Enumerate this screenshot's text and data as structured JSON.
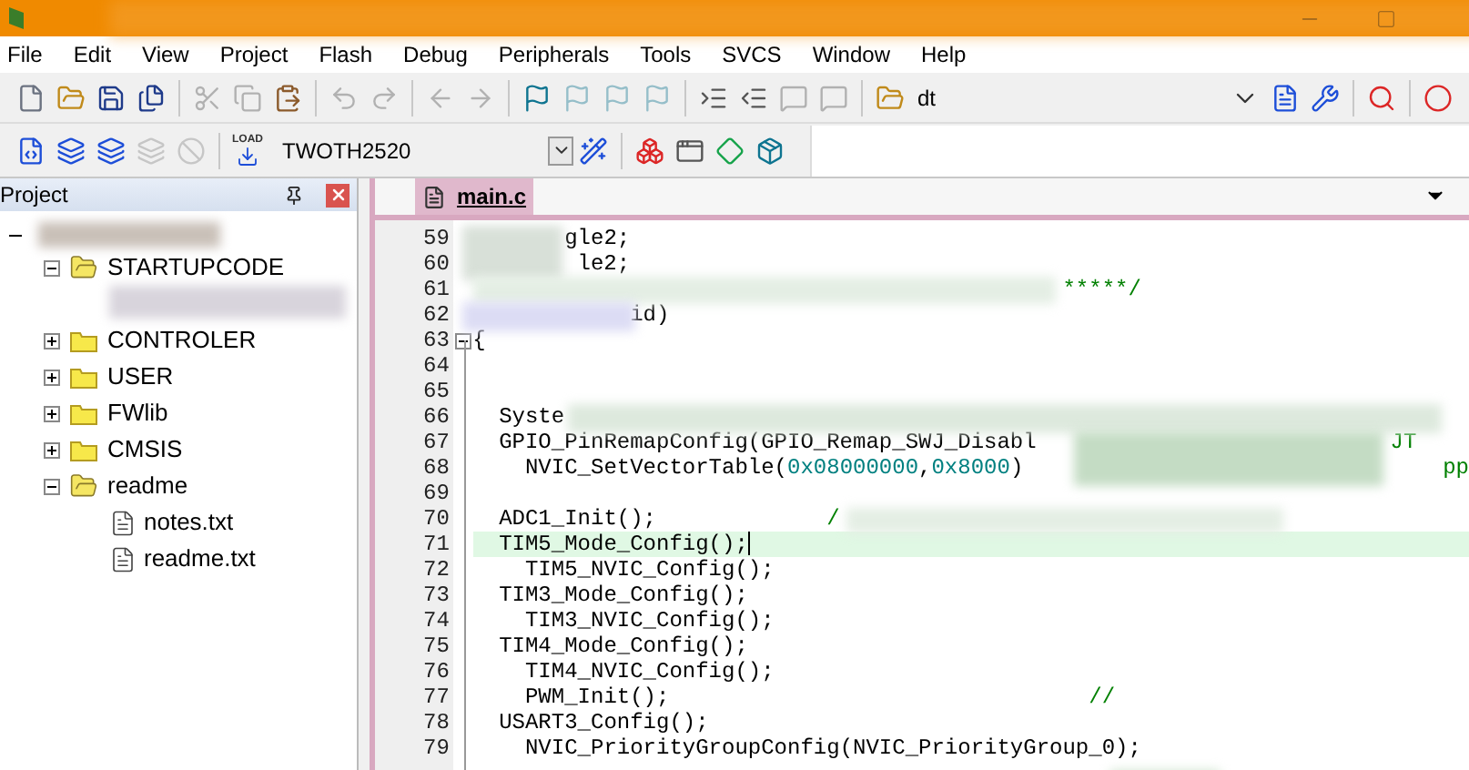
{
  "menu": [
    {
      "label": "File"
    },
    {
      "label": "Edit"
    },
    {
      "label": "View"
    },
    {
      "label": "Project"
    },
    {
      "label": "Flash"
    },
    {
      "label": "Debug"
    },
    {
      "label": "Peripherals"
    },
    {
      "label": "Tools"
    },
    {
      "label": "SVCS"
    },
    {
      "label": "Window"
    },
    {
      "label": "Help"
    }
  ],
  "toolbar": [
    {
      "kind": "new",
      "disabled": false
    },
    {
      "kind": "open",
      "disabled": false
    },
    {
      "kind": "save",
      "disabled": false
    },
    {
      "kind": "saveall",
      "disabled": false
    },
    {
      "kind": "sep"
    },
    {
      "kind": "cut",
      "disabled": true
    },
    {
      "kind": "copy",
      "disabled": true
    },
    {
      "kind": "paste",
      "disabled": false
    },
    {
      "kind": "sep"
    },
    {
      "kind": "undo",
      "disabled": true
    },
    {
      "kind": "redo",
      "disabled": true
    },
    {
      "kind": "sep"
    },
    {
      "kind": "back",
      "disabled": true
    },
    {
      "kind": "forward",
      "disabled": true
    },
    {
      "kind": "sep"
    },
    {
      "kind": "flag",
      "disabled": false
    },
    {
      "kind": "flag",
      "disabled": true
    },
    {
      "kind": "flag",
      "disabled": true
    },
    {
      "kind": "flag",
      "disabled": true
    },
    {
      "kind": "sep"
    },
    {
      "kind": "indent",
      "disabled": false
    },
    {
      "kind": "outdent",
      "disabled": false
    },
    {
      "kind": "comment",
      "disabled": true
    },
    {
      "kind": "comment",
      "disabled": true
    },
    {
      "kind": "sep"
    },
    {
      "kind": "open",
      "disabled": false
    }
  ],
  "find": {
    "value": "dt"
  },
  "toolbar_right": [
    {
      "kind": "dropdown",
      "disabled": false
    },
    {
      "kind": "doc",
      "disabled": false
    },
    {
      "kind": "tool",
      "disabled": false
    },
    {
      "kind": "sep"
    },
    {
      "kind": "debug",
      "disabled": false
    },
    {
      "kind": "sep"
    },
    {
      "kind": "breakpoint",
      "disabled": false
    }
  ],
  "build_toolbar": [
    {
      "kind": "translate",
      "disabled": false
    },
    {
      "kind": "build",
      "disabled": false
    },
    {
      "kind": "rebuild",
      "disabled": false
    },
    {
      "kind": "batch",
      "disabled": true
    },
    {
      "kind": "stop",
      "disabled": true
    },
    {
      "kind": "sep"
    },
    {
      "kind": "load",
      "label": "LOAD",
      "disabled": false
    }
  ],
  "target": {
    "value": "TWOTH2520"
  },
  "build_toolbar_right": [
    {
      "kind": "wand",
      "disabled": false
    },
    {
      "kind": "sep"
    },
    {
      "kind": "blocks",
      "disabled": false
    },
    {
      "kind": "windows",
      "disabled": false
    },
    {
      "kind": "diamond",
      "disabled": false
    },
    {
      "kind": "packs",
      "disabled": false
    }
  ],
  "project": {
    "title": "Project",
    "tree": {
      "expanded": true,
      "children": [
        {
          "kind": "folder",
          "label": "STARTUPCODE",
          "expanded": true,
          "children": [
            {
              "kind": "redacted"
            }
          ]
        },
        {
          "kind": "folder",
          "label": "CONTROLER",
          "expanded": false
        },
        {
          "kind": "folder",
          "label": "USER",
          "expanded": false
        },
        {
          "kind": "folder",
          "label": "FWlib",
          "expanded": false
        },
        {
          "kind": "folder",
          "label": "CMSIS",
          "expanded": false
        },
        {
          "kind": "folder",
          "label": "readme",
          "expanded": true,
          "children": [
            {
              "kind": "file",
              "label": "notes.txt"
            },
            {
              "kind": "file",
              "label": "readme.txt"
            }
          ]
        }
      ]
    }
  },
  "editor": {
    "tabs": [
      {
        "label": "main.c",
        "selected": true
      }
    ],
    "lines": [
      {
        "number": "59",
        "current": false,
        "segments": [
          {
            "kind": "plain",
            "text": "       gle2;"
          }
        ]
      },
      {
        "number": "60",
        "current": false,
        "segments": [
          {
            "kind": "plain",
            "text": "        le2;"
          }
        ]
      },
      {
        "number": "61",
        "current": false,
        "segments": [
          {
            "kind": "comment",
            "text": "                                             *****/"
          }
        ]
      },
      {
        "number": "62",
        "current": false,
        "segments": [
          {
            "kind": "plain",
            "text": "            id)"
          }
        ]
      },
      {
        "number": "63",
        "current": false,
        "fold": true,
        "segments": [
          {
            "kind": "plain",
            "text": "{"
          }
        ]
      },
      {
        "number": "64",
        "current": false
      },
      {
        "number": "65",
        "current": false
      },
      {
        "number": "66",
        "current": false,
        "segments": [
          {
            "kind": "plain",
            "text": "  Syste"
          }
        ]
      },
      {
        "number": "67",
        "current": false,
        "segments": [
          {
            "kind": "plain",
            "text": "  GPIO_PinRemapConfig(GPIO_Remap_SWJ_Disabl"
          },
          {
            "kind": "comment",
            "text": "                           JT"
          }
        ]
      },
      {
        "number": "68",
        "current": false,
        "segments": [
          {
            "kind": "plain",
            "text": "    NVIC_SetVectorTable("
          },
          {
            "kind": "number",
            "text": "0x08000000"
          },
          {
            "kind": "plain",
            "text": ","
          },
          {
            "kind": "number",
            "text": "0x8000"
          },
          {
            "kind": "plain",
            "text": ")"
          },
          {
            "kind": "comment",
            "text": "                                pp"
          }
        ]
      },
      {
        "number": "69",
        "current": false
      },
      {
        "number": "70",
        "current": false,
        "segments": [
          {
            "kind": "plain",
            "text": "  ADC1_Init();"
          },
          {
            "kind": "comment",
            "text": "             /"
          }
        ]
      },
      {
        "number": "71",
        "current": true,
        "segments": [
          {
            "kind": "plain",
            "text": "  TIM5_Mode_Config();"
          }
        ]
      },
      {
        "number": "72",
        "current": false,
        "segments": [
          {
            "kind": "plain",
            "text": "    TIM5_NVIC_Config();"
          }
        ]
      },
      {
        "number": "73",
        "current": false,
        "segments": [
          {
            "kind": "plain",
            "text": "  TIM3_Mode_Config();"
          }
        ]
      },
      {
        "number": "74",
        "current": false,
        "segments": [
          {
            "kind": "plain",
            "text": "    TIM3_NVIC_Config();"
          }
        ]
      },
      {
        "number": "75",
        "current": false,
        "segments": [
          {
            "kind": "plain",
            "text": "  TIM4_Mode_Config();"
          }
        ]
      },
      {
        "number": "76",
        "current": false,
        "segments": [
          {
            "kind": "plain",
            "text": "    TIM4_NVIC_Config();"
          }
        ]
      },
      {
        "number": "77",
        "current": false,
        "segments": [
          {
            "kind": "plain",
            "text": "    PWM_Init();"
          },
          {
            "kind": "comment",
            "text": "                                //"
          }
        ]
      },
      {
        "number": "78",
        "current": false,
        "segments": [
          {
            "kind": "plain",
            "text": "  USART3_Config();"
          }
        ]
      },
      {
        "number": "79",
        "current": false,
        "segments": [
          {
            "kind": "plain",
            "text": "    NVIC_PriorityGroupConfig(NVIC_PriorityGroup_0);"
          }
        ]
      }
    ]
  }
}
